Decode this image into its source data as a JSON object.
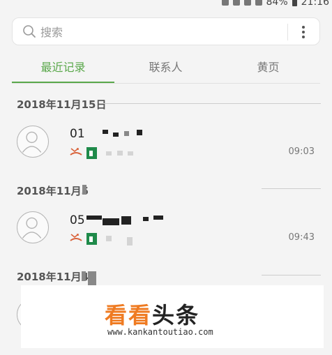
{
  "status_bar": {
    "battery": "84%",
    "time": "21:16"
  },
  "search": {
    "placeholder": "搜索"
  },
  "tabs": [
    {
      "label": "最近记录",
      "active": true
    },
    {
      "label": "联系人",
      "active": false
    },
    {
      "label": "黄页",
      "active": false
    }
  ],
  "accent_color": "#5aa84b",
  "call_log": [
    {
      "date": "2018年11月15日",
      "number_prefix": "01",
      "time": "09:03"
    },
    {
      "date": "2018年11月5",
      "number_prefix": "05",
      "time": "09:43"
    },
    {
      "date": "2018年11月4",
      "number_prefix": "",
      "time": ""
    }
  ],
  "watermark": {
    "title_part1": "看看",
    "title_part2": "头条",
    "url": "www.kankantoutiao.com"
  }
}
